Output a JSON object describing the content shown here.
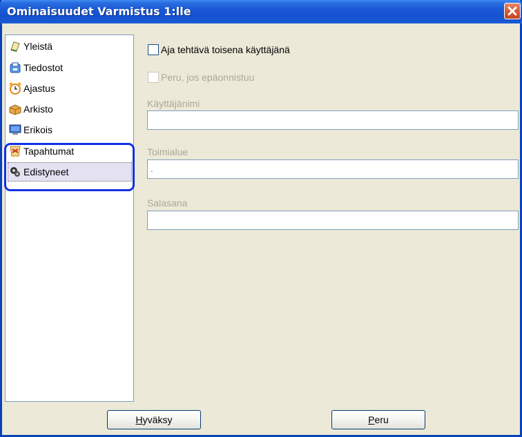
{
  "window": {
    "title": "Ominaisuudet Varmistus 1:lle"
  },
  "sidebar": {
    "items": [
      {
        "label": "Yleistä",
        "icon": "general-icon"
      },
      {
        "label": "Tiedostot",
        "icon": "files-icon"
      },
      {
        "label": "Ajastus",
        "icon": "alarm-clock-icon"
      },
      {
        "label": "Arkisto",
        "icon": "archive-box-icon"
      },
      {
        "label": "Erikois",
        "icon": "monitor-icon"
      },
      {
        "label": "Tapahtumat",
        "icon": "events-icon"
      },
      {
        "label": "Edistyneet",
        "icon": "advanced-icon",
        "selected": true
      }
    ]
  },
  "main": {
    "run_as_user_label": "Aja tehtävä toisena käyttäjänä",
    "revert_on_fail_label": "Peru, jos epäonnistuu",
    "username": {
      "label": "Käyttäjänimi",
      "value": ""
    },
    "domain": {
      "label": "Toimialue",
      "value": "."
    },
    "password": {
      "label": "Salasana",
      "value": ""
    }
  },
  "buttons": {
    "ok_first": "H",
    "ok_rest": "yväksy",
    "cancel_first": "P",
    "cancel_rest": "eru"
  },
  "colors": {
    "titlebar": "#1a58d6",
    "close": "#d85a36",
    "highlight_ring": "#1030e8",
    "selected_bg": "#e3e1f2"
  }
}
